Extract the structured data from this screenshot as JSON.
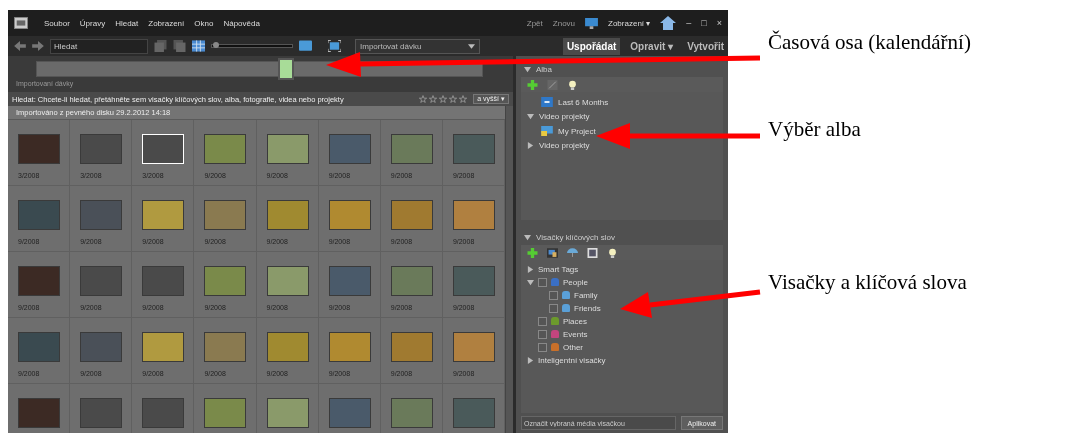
{
  "menu_bar": {
    "items": [
      "Soubor",
      "Úpravy",
      "Hledat",
      "Zobrazení",
      "Okno",
      "Nápověda"
    ],
    "undo": "Zpět",
    "redo": "Znovu",
    "view_button": "Zobrazení ▾",
    "window_controls": [
      "–",
      "□",
      "×"
    ]
  },
  "toolbar": {
    "search": {
      "value": "Hledat"
    },
    "thumb_size": {
      "level": 0.05
    },
    "batch_dropdown": "Importovat dávku",
    "tabs": [
      {
        "label": "Uspořádat",
        "selected": true
      },
      {
        "label": "Opravit ▾",
        "selected": false
      },
      {
        "label": "Vytvořit",
        "selected": false
      }
    ]
  },
  "timeline": {
    "level": 0.56,
    "label": "Importovaní dávky"
  },
  "search_bar": {
    "text": "Hledat: Chcete-li hledat, přetáhněte sem visačky klíčových slov, alba, fotografie, videa nebo projekty",
    "stars": 0,
    "rating_filter": "a vyšší ▾"
  },
  "media": {
    "group_header": "Importováno z pevného disku 29.2.2012 14:18",
    "rows": [
      [
        {
          "date": "3/2008",
          "selected": false
        },
        {
          "date": "3/2008",
          "selected": false
        },
        {
          "date": "3/2008",
          "selected": true
        },
        {
          "date": "9/2008",
          "selected": false
        },
        {
          "date": "9/2008",
          "selected": false
        },
        {
          "date": "9/2008",
          "selected": false
        },
        {
          "date": "9/2008",
          "selected": false
        },
        {
          "date": "9/2008",
          "selected": false
        }
      ],
      [
        {
          "date": "9/2008",
          "selected": false
        },
        {
          "date": "9/2008",
          "selected": false
        },
        {
          "date": "9/2008",
          "selected": false
        },
        {
          "date": "9/2008",
          "selected": false
        },
        {
          "date": "9/2008",
          "selected": false
        },
        {
          "date": "9/2008",
          "selected": false
        },
        {
          "date": "9/2008",
          "selected": false
        },
        {
          "date": "9/2008",
          "selected": false
        }
      ],
      [
        {
          "date": "9/2008",
          "selected": false
        },
        {
          "date": "9/2008",
          "selected": false
        },
        {
          "date": "9/2008",
          "selected": false
        },
        {
          "date": "9/2008",
          "selected": false
        },
        {
          "date": "9/2008",
          "selected": false
        },
        {
          "date": "9/2008",
          "selected": false
        },
        {
          "date": "9/2008",
          "selected": false
        },
        {
          "date": "9/2008",
          "selected": false
        }
      ],
      [
        {
          "date": "9/2008",
          "selected": false
        },
        {
          "date": "9/2008",
          "selected": false
        },
        {
          "date": "9/2008",
          "selected": false
        },
        {
          "date": "9/2008",
          "selected": false
        },
        {
          "date": "9/2008",
          "selected": false
        },
        {
          "date": "9/2008",
          "selected": false
        },
        {
          "date": "9/2008",
          "selected": false
        },
        {
          "date": "9/2008",
          "selected": false
        }
      ],
      [
        {
          "selected": false
        },
        {
          "selected": false
        },
        {
          "selected": false
        },
        {
          "selected": false
        },
        {
          "selected": false
        },
        {
          "selected": false
        },
        {
          "selected": false
        },
        {
          "selected": false
        }
      ]
    ]
  },
  "albums_panel": {
    "title": "Alba",
    "items": [
      {
        "label": "Last 6 Months",
        "kind": "album"
      },
      {
        "label": "Video projekty",
        "kind": "folder",
        "expanded": true,
        "children": [
          {
            "label": "My Project",
            "kind": "project"
          }
        ]
      },
      {
        "label": "Video projekty",
        "kind": "folder",
        "expanded": false
      }
    ]
  },
  "tags_panel": {
    "title": "Visačky klíčových slov",
    "items": [
      {
        "label": "Smart Tags",
        "kind": "group",
        "expanded": false
      },
      {
        "label": "People",
        "kind": "tag",
        "checked": false,
        "color": "#3a6fc4",
        "expanded": true,
        "children": [
          {
            "label": "Family",
            "checked": false,
            "color": "#5aa0d8"
          },
          {
            "label": "Friends",
            "checked": false,
            "color": "#5aa0d8"
          }
        ]
      },
      {
        "label": "Places",
        "kind": "tag",
        "checked": false,
        "color": "#6c9a2c"
      },
      {
        "label": "Events",
        "kind": "tag",
        "checked": false,
        "color": "#c2457e"
      },
      {
        "label": "Other",
        "kind": "tag",
        "checked": false,
        "color": "#c8702a"
      },
      {
        "label": "Inteligentní visačky",
        "kind": "group",
        "expanded": false
      }
    ],
    "tag_field": {
      "placeholder": "Označit vybraná média visačkou"
    },
    "apply_button": "Aplikovat"
  },
  "annotations": [
    "Časová osa (kalendářní)",
    "Výběr alba",
    "Visačky a klíčová slova"
  ]
}
